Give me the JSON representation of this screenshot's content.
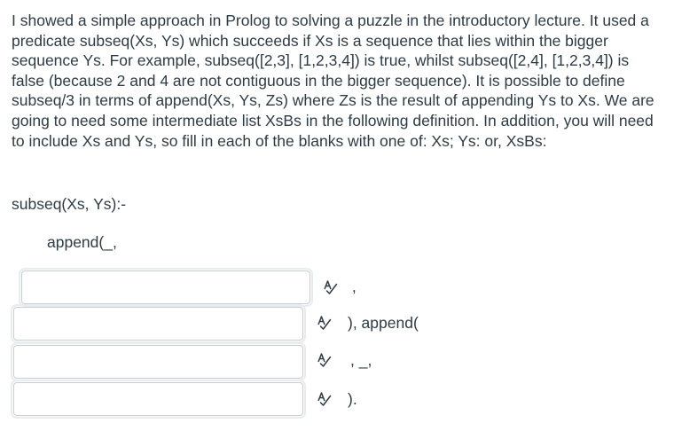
{
  "question": {
    "text": "I showed a simple approach in Prolog to solving a puzzle in the introductory lecture. It used a predicate subseq(Xs, Ys) which succeeds if Xs is a sequence that lies within the bigger sequence Ys. For example, subseq([2,3], [1,2,3,4]) is true, whilst subseq([2,4], [1,2,3,4]) is false (because 2 and 4 are not contiguous in the bigger sequence). It is possible to define subseq/3 in terms of append(Xs, Ys, Zs) where Zs is the result of appending Ys to Xs. We are going to need some intermediate list XsBs in the following definition. In addition, you will need to include Xs and Ys, so fill in each of the blanks with one of: Xs; Ys: or, XsBs:"
  },
  "code": {
    "head": "subseq(Xs, Ys):-",
    "append_start": "append(_,"
  },
  "blanks": [
    {
      "value": "",
      "after": " ,",
      "icon": "spellcheck-icon"
    },
    {
      "value": "",
      "after": "), append(",
      "icon": "spellcheck-icon"
    },
    {
      "value": "",
      "after": ", _,",
      "icon": "spellcheck-icon"
    },
    {
      "value": "",
      "after": ").",
      "icon": "spellcheck-icon"
    }
  ],
  "colors": {
    "text": "#2d3b45",
    "input_border": "#c7cdd1"
  }
}
